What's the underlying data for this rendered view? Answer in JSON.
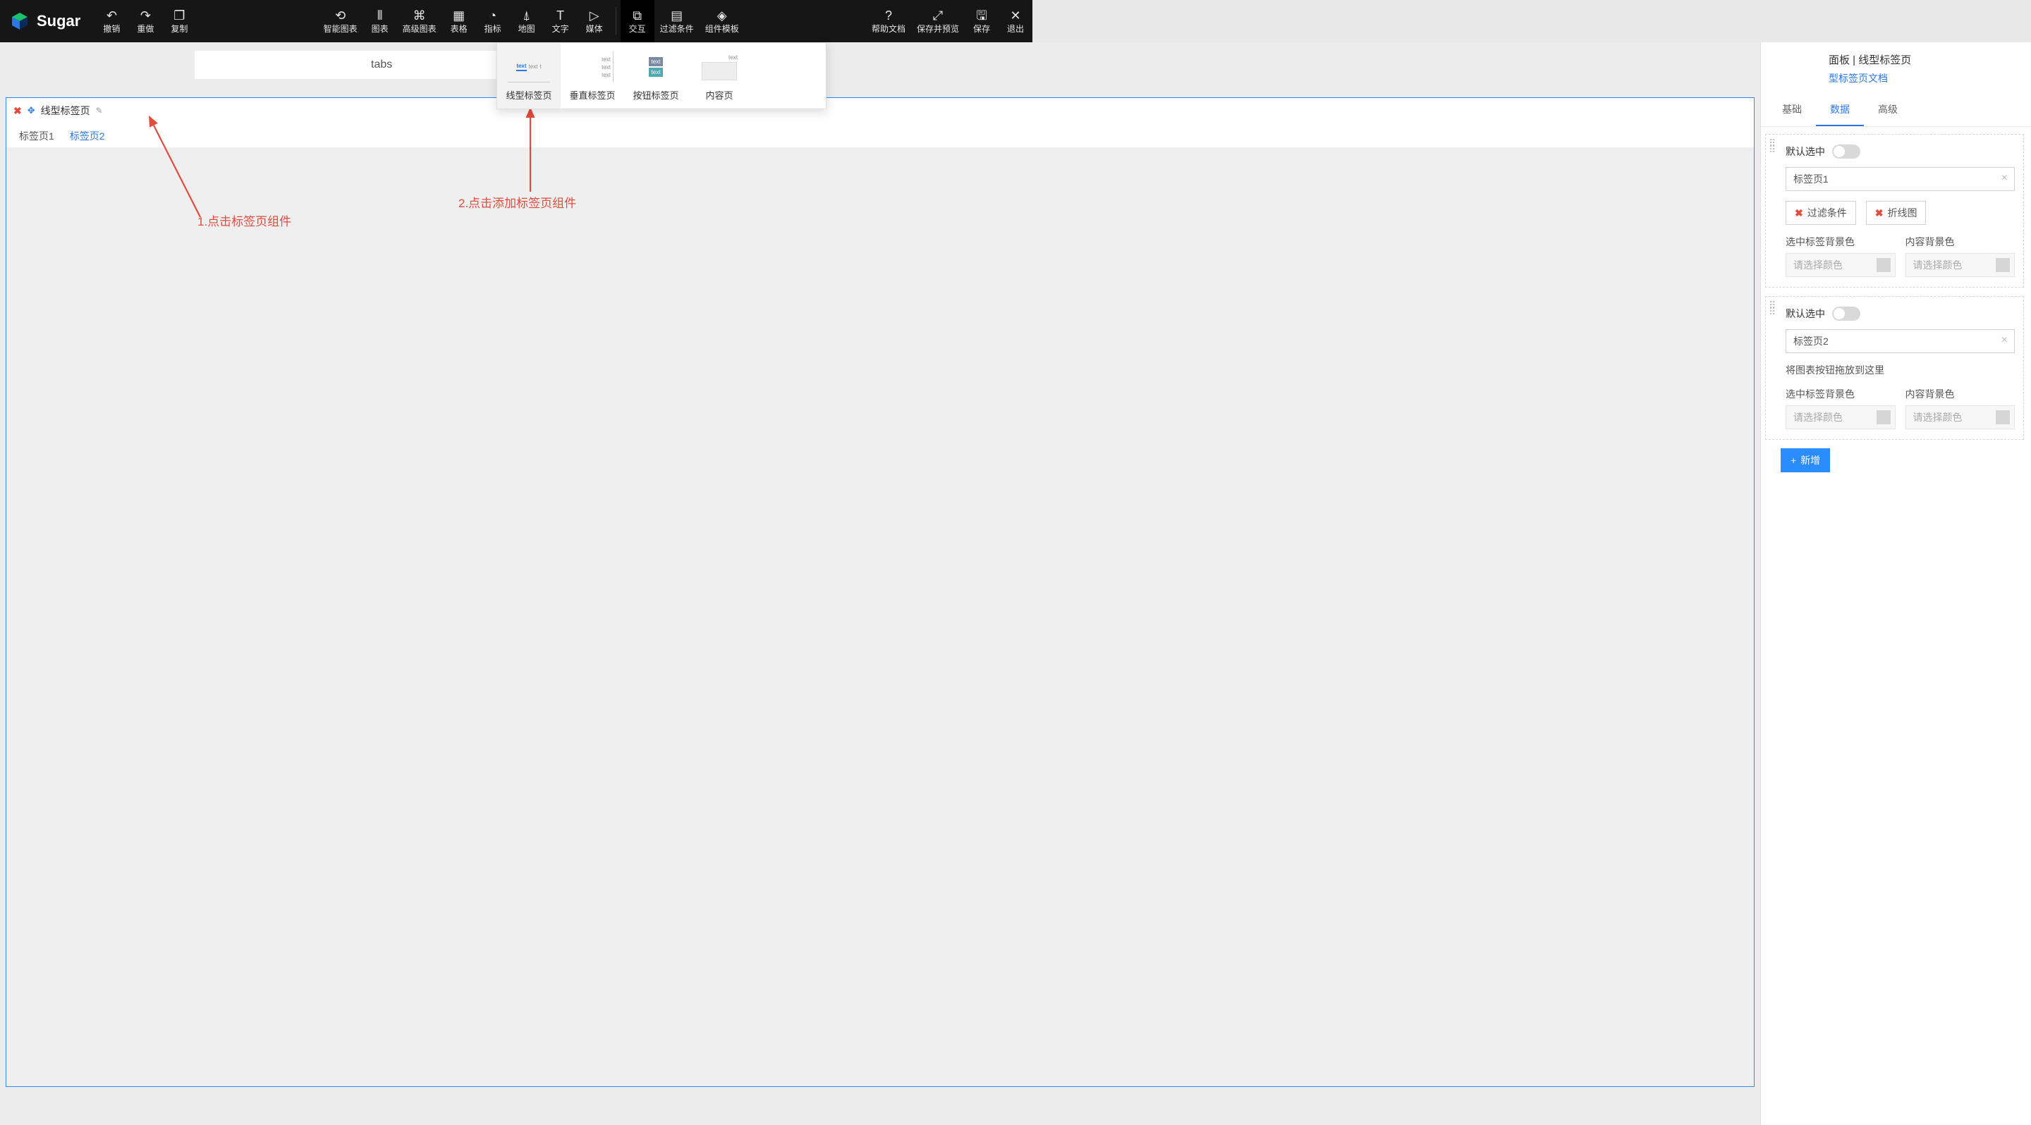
{
  "brand": "Sugar",
  "topbar": {
    "left": [
      {
        "icon": "↶",
        "label": "撤销"
      },
      {
        "icon": "↷",
        "label": "重做"
      },
      {
        "icon": "❐",
        "label": "复制"
      }
    ],
    "center": [
      {
        "icon": "⟲",
        "label": "智能图表"
      },
      {
        "icon": "⫴",
        "label": "图表"
      },
      {
        "icon": "⌘",
        "label": "高级图表"
      },
      {
        "icon": "▦",
        "label": "表格"
      },
      {
        "icon": "◔",
        "label": "指标"
      },
      {
        "icon": "⍋",
        "label": "地图"
      },
      {
        "icon": "T",
        "label": "文字"
      },
      {
        "icon": "▷",
        "label": "媒体"
      }
    ],
    "center2": [
      {
        "icon": "⧉",
        "label": "交互",
        "active": true
      },
      {
        "icon": "▤",
        "label": "过滤条件"
      },
      {
        "icon": "◈",
        "label": "组件模板"
      }
    ],
    "right": [
      {
        "icon": "?",
        "label": "帮助文档"
      },
      {
        "icon": "⤢",
        "label": "保存并预览"
      },
      {
        "icon": "🖫",
        "label": "保存"
      },
      {
        "icon": "✕",
        "label": "退出"
      }
    ]
  },
  "dropdown": {
    "items": [
      {
        "label": "线型标签页"
      },
      {
        "label": "垂直标签页"
      },
      {
        "label": "按钮标签页"
      },
      {
        "label": "内容页"
      }
    ]
  },
  "tabs_display": "tabs",
  "component": {
    "title": "线型标签页",
    "tabs": [
      "标签页1",
      "标签页2"
    ],
    "activeIndex": 1
  },
  "annotations": {
    "a1": "1.点击标签页组件",
    "a2": "2.点击添加标签页组件"
  },
  "panel": {
    "title_suffix": "面板 | 线型标签页",
    "doc_link": "型标签页文档",
    "tabs": [
      "基础",
      "数据",
      "高级"
    ],
    "activeTab": 1,
    "section_default_selected": "默认选中",
    "tab1_name": "标签页1",
    "tab2_name": "标签页2",
    "chip_filter": "过滤条件",
    "chip_line": "折线图",
    "sel_bg_label": "选中标签背景色",
    "content_bg_label": "内容背景色",
    "color_placeholder": "请选择颜色",
    "drop_hint": "将图表按钮拖放到这里",
    "add_label": "新增"
  }
}
